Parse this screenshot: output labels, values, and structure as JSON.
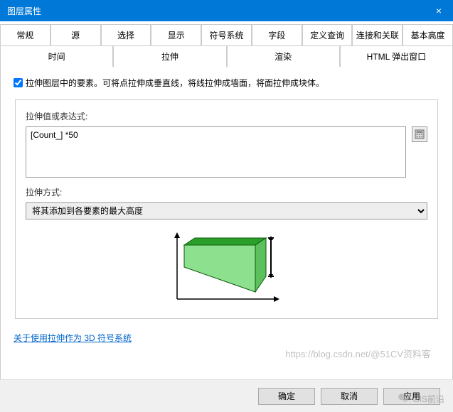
{
  "window": {
    "title": "图层属性",
    "close": "×"
  },
  "tabs_row1": [
    {
      "label": "常规"
    },
    {
      "label": "源"
    },
    {
      "label": "选择"
    },
    {
      "label": "显示"
    },
    {
      "label": "符号系统"
    },
    {
      "label": "字段"
    },
    {
      "label": "定义查询"
    },
    {
      "label": "连接和关联"
    },
    {
      "label": "基本高度"
    }
  ],
  "tabs_row2": [
    {
      "label": "时间"
    },
    {
      "label": "拉伸",
      "active": true
    },
    {
      "label": "渲染"
    },
    {
      "label": "HTML 弹出窗口"
    }
  ],
  "checkbox": {
    "checked": true,
    "text": "拉伸图层中的要素。可将点拉伸成垂直线，将线拉伸成墙面，将面拉伸成块体。"
  },
  "expr": {
    "label": "拉伸值或表达式:",
    "value": "[Count_] *50"
  },
  "method": {
    "label": "拉伸方式:",
    "selected": "将其添加到各要素的最大高度"
  },
  "link": "关于使用拉伸作为 3D 符号系统",
  "buttons": {
    "ok": "确定",
    "cancel": "取消",
    "apply": "应用"
  },
  "watermark": "https://blog.csdn.net/@51CV资料客",
  "watermark2": "GIS前沿"
}
